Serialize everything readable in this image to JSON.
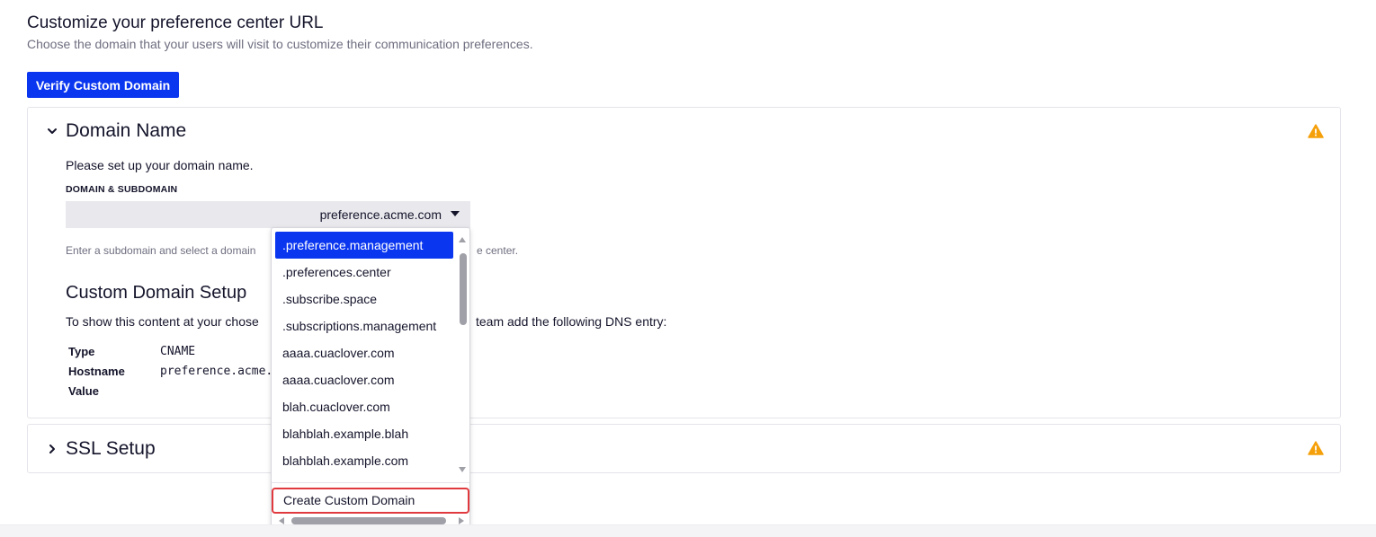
{
  "header": {
    "title": "Customize your preference center URL",
    "subtitle": "Choose the domain that your users will visit to customize their communication preferences."
  },
  "verify_button": {
    "label": "Verify Custom Domain"
  },
  "domain_panel": {
    "title": "Domain Name",
    "status_icon": "warning-icon",
    "info": "Please set up your domain name.",
    "field_label": "DOMAIN & SUBDOMAIN",
    "selected_value": "preference.acme.com",
    "help_text_left": "Enter a subdomain and select a domain",
    "help_text_right": "e center.",
    "setup": {
      "title": "Custom Domain Setup",
      "description_left": "To show this content at your chose",
      "description_right": "team add the following DNS entry:",
      "rows": [
        {
          "label": "Type",
          "value": "CNAME"
        },
        {
          "label": "Hostname",
          "value": "preference.acme."
        },
        {
          "label": "Value",
          "value": ""
        }
      ]
    }
  },
  "ssl_panel": {
    "title": "SSL Setup",
    "status_icon": "warning-icon"
  },
  "dropdown": {
    "options": [
      ".preference.management",
      ".preferences.center",
      ".subscribe.space",
      ".subscriptions.management",
      "aaaa.cuaclover.com",
      "aaaa.cuaclover.com",
      "blah.cuaclover.com",
      "blahblah.example.blah",
      "blahblah.example.com"
    ],
    "selected_index": 0,
    "create_label": "Create Custom Domain"
  },
  "colors": {
    "accent": "#0a36f0",
    "warning": "#f5a00a",
    "highlight_border": "#e03a3e"
  }
}
